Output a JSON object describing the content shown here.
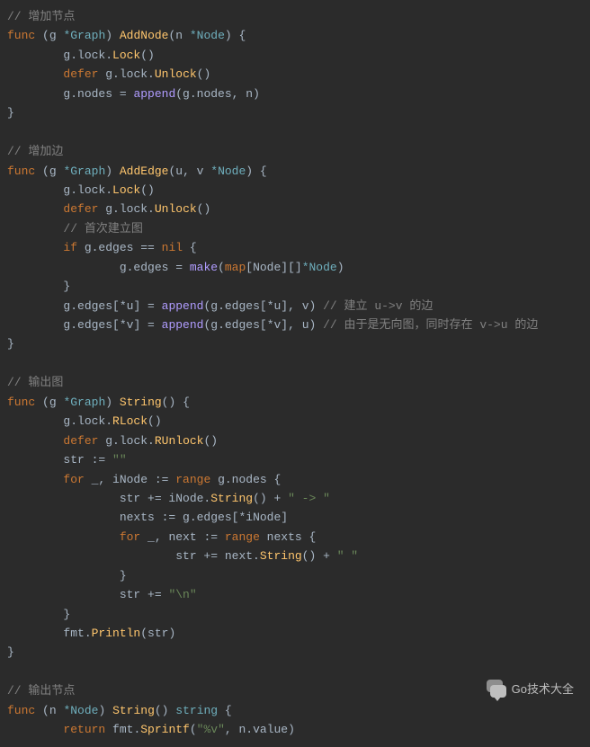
{
  "code": {
    "comment_add_node": "// 增加节点",
    "kw_func": "func",
    "recv_g": "(g ",
    "ptr_graph": "*Graph",
    "close_recv": ") ",
    "method_addnode": "AddNode",
    "param_addnode_open": "(n ",
    "ptr_node": "*Node",
    "close_param_brace": ") {",
    "addnode_l1": "        g.lock.",
    "lock": "Lock",
    "call": "()",
    "addnode_l2": "        ",
    "kw_defer": "defer",
    "sp": " ",
    "unlock_call": "g.lock.",
    "unlock": "Unlock",
    "addnode_l3a": "        g.nodes = ",
    "append": "append",
    "addnode_l3b": "(g.nodes, n)",
    "brace_close": "}",
    "comment_add_edge": "// 增加边",
    "method_addedge": "AddEdge",
    "param_addedge": "(u, v ",
    "addedge_l1": "        g.lock.",
    "addedge_l2": "        ",
    "comment_first_build": "        // 首次建立图",
    "addedge_if": "        ",
    "kw_if": "if",
    "if_cond": " g.edges == ",
    "kw_nil": "nil",
    "brace_open_sp": " {",
    "addedge_make_a": "                g.edges = ",
    "make": "make",
    "addedge_make_b": "(",
    "kw_map": "map",
    "addedge_make_c": "[Node][]",
    "addedge_make_d": ")",
    "brace_close_ind": "        }",
    "addedge_u_a": "        g.edges[",
    "deref": "*",
    "addedge_u_b": "u] = ",
    "addedge_u_c": "(g.edges[",
    "addedge_u_d": "u], v)",
    "comment_edge_uv": " // 建立 u->v 的边",
    "addedge_v_b": "v] = ",
    "addedge_v_d": "v], u)",
    "comment_edge_vu": " // 由于是无向图，同时存在 v->u 的边",
    "comment_output_graph": "// 输出图",
    "method_string": "String",
    "empty_params_brace": "() {",
    "string_l1": "        g.lock.",
    "rlock": "RLock",
    "string_l2": "        ",
    "runlock": "RUnlock",
    "string_l3a": "        str := ",
    "str_empty": "\"\"",
    "string_for1a": "        ",
    "kw_for": "for",
    "string_for1b": " _, iNode := ",
    "kw_range": "range",
    "string_for1c": " g.nodes {",
    "string_l5a": "                str += iNode.",
    "string_l5b": "() + ",
    "str_arrow": "\" -> \"",
    "string_l6a": "                nexts := g.edges[",
    "string_l6b": "iNode]",
    "string_for2a": "                ",
    "string_for2b": " _, next := ",
    "string_for2c": " nexts {",
    "string_l8a": "                        str += next.",
    "string_l8b": "() + ",
    "str_space": "\" \"",
    "brace_close_ind2": "                }",
    "string_l10a": "                str += ",
    "str_newline": "\"\\n\"",
    "string_l12a": "        fmt.",
    "println": "Println",
    "string_l12b": "(str)",
    "comment_output_node": "// 输出节点",
    "recv_n": "(n ",
    "ret_string": " string",
    "empty_params": "()",
    "return_a": "        ",
    "kw_return": "return",
    "return_b": " fmt.",
    "sprintf": "Sprintf",
    "return_c": "(",
    "str_fmtv": "\"%v\"",
    "return_d": ", n.value)"
  },
  "watermark": {
    "text": "Go技术大全"
  }
}
